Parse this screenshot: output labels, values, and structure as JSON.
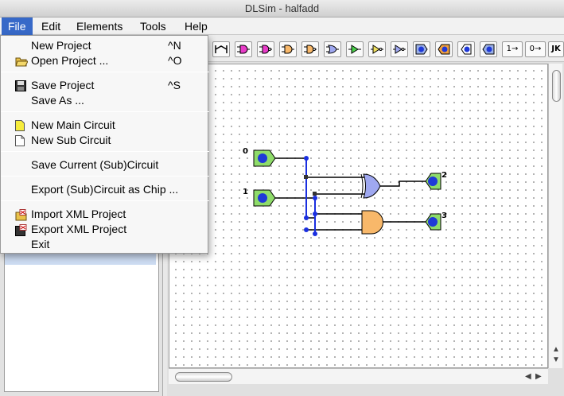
{
  "window": {
    "title": "DLSim - halfadd"
  },
  "menubar": {
    "items": [
      {
        "label": "File"
      },
      {
        "label": "Edit"
      },
      {
        "label": "Elements"
      },
      {
        "label": "Tools"
      },
      {
        "label": "Help"
      }
    ]
  },
  "file_menu": {
    "items": [
      {
        "label": "New Project",
        "shortcut": "^N",
        "icon": "new-project-icon"
      },
      {
        "label": "Open Project ...",
        "shortcut": "^O",
        "icon": "open-folder-icon"
      },
      {
        "label": "Save Project",
        "shortcut": "^S",
        "icon": "save-disk-icon"
      },
      {
        "label": "Save As ...",
        "shortcut": "",
        "icon": ""
      },
      {
        "label": "New Main Circuit",
        "shortcut": "",
        "icon": "new-main-circuit-icon"
      },
      {
        "label": "New Sub Circuit",
        "shortcut": "",
        "icon": "new-sub-circuit-icon"
      },
      {
        "label": "Save Current (Sub)Circuit",
        "shortcut": "",
        "icon": ""
      },
      {
        "label": "Export (Sub)Circuit as Chip ...",
        "shortcut": "",
        "icon": ""
      },
      {
        "label": "Import XML Project",
        "shortcut": "",
        "icon": "import-xml-icon"
      },
      {
        "label": "Export XML Project",
        "shortcut": "",
        "icon": "export-xml-icon"
      },
      {
        "label": "Exit",
        "shortcut": "",
        "icon": ""
      }
    ]
  },
  "toolbar": {
    "const_one_label": "1→",
    "const_zero_label": "0→",
    "jk_label": "JK"
  },
  "circuit": {
    "labels": [
      "0",
      "1",
      "2",
      "3"
    ]
  },
  "colors": {
    "menu_highlight": "#3769c8",
    "io_green": "#8fdc6a",
    "io_blue": "#1f39d8",
    "xor_blue": "#9fa8f0",
    "and_orange": "#f8b86a",
    "wire_blue": "#1a2fe0"
  }
}
